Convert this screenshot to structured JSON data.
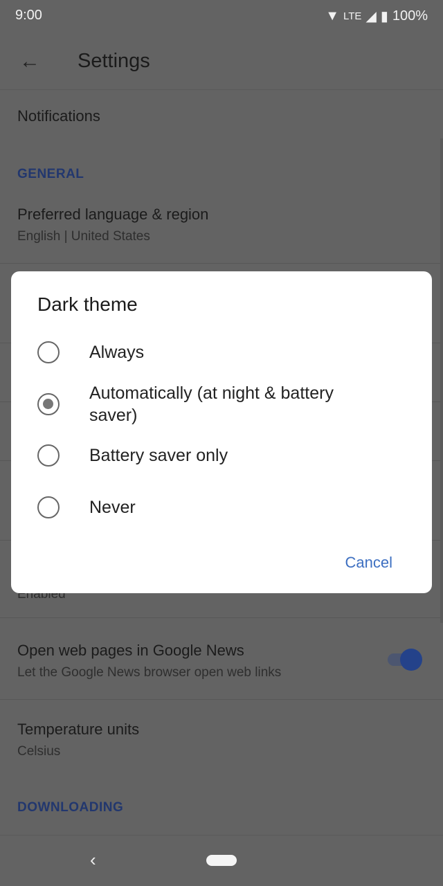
{
  "status": {
    "time": "9:00",
    "network": "LTE",
    "battery": "100%"
  },
  "appbar": {
    "title": "Settings"
  },
  "settings": {
    "notifications": "Notifications",
    "general_header": "GENERAL",
    "language_title": "Preferred language & region",
    "language_value": "English | United States",
    "hidden_partial": "Enabled",
    "webpages_title": "Open web pages in Google News",
    "webpages_sub": "Let the Google News browser open web links",
    "webpages_enabled": true,
    "temp_title": "Temperature units",
    "temp_value": "Celsius",
    "downloading_header": "DOWNLOADING"
  },
  "dialog": {
    "title": "Dark theme",
    "options": [
      {
        "label": "Always",
        "selected": false
      },
      {
        "label": "Automatically (at night & battery saver)",
        "selected": true
      },
      {
        "label": "Battery saver only",
        "selected": false
      },
      {
        "label": "Never",
        "selected": false
      }
    ],
    "cancel": "Cancel"
  },
  "colors": {
    "accent": "#3d6fc1",
    "section": "#22376e"
  }
}
